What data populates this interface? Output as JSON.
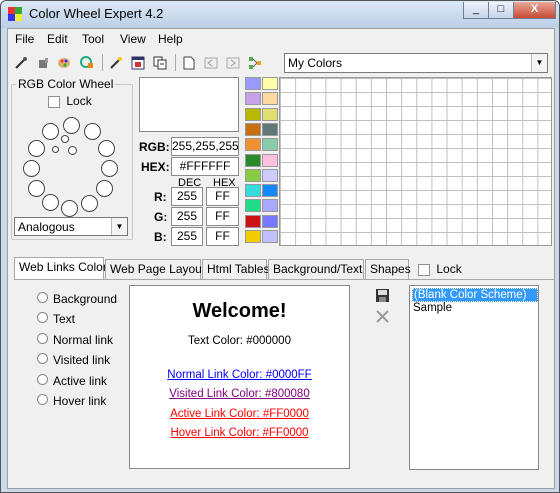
{
  "window": {
    "title": "Color Wheel Expert 4.2",
    "controls": [
      "_",
      "□",
      "X"
    ]
  },
  "menu": [
    {
      "label": "File"
    },
    {
      "label": "Edit"
    },
    {
      "label": "Tool"
    },
    {
      "label": "View"
    },
    {
      "label": "Help"
    }
  ],
  "toolbar": {
    "scheme_combo": "My Colors"
  },
  "wheel_panel": {
    "title": "RGB Color Wheel",
    "lock_label": "Lock",
    "scheme_select": "Analogous"
  },
  "color_info": {
    "rgb_label": "RGB:",
    "rgb_value": "255,255,255",
    "hex_label": "HEX:",
    "hex_value": "#FFFFFF",
    "dec_header": "DEC",
    "hex_header": "HEX",
    "r_label": "R:",
    "g_label": "G:",
    "b_label": "B:",
    "r_dec": "255",
    "g_dec": "255",
    "b_dec": "255",
    "r_hex": "FF",
    "g_hex": "FF",
    "b_hex": "FF",
    "preview_color": "#FFFFFF"
  },
  "palette": {
    "column1": [
      "#9999ff",
      "#c8a2e8",
      "#b8b800",
      "#c87010",
      "#f09030",
      "#2a8a2a",
      "#88cc44",
      "#33dddd",
      "#22dd88",
      "#cc1111",
      "#eecc00"
    ],
    "column2": [
      "#ffffaa",
      "#ffd8a0",
      "#e0e070",
      "#607878",
      "#88ccaa",
      "#ffc0e0",
      "#ccccff",
      "#1188ff",
      "#a8a8ff",
      "#7777ff",
      "#c0c0ff"
    ]
  },
  "tabs": [
    {
      "label": "Web Links Color",
      "active": true
    },
    {
      "label": "Web Page Layout"
    },
    {
      "label": "Html Tables"
    },
    {
      "label": "Background/Text"
    },
    {
      "label": "Shapes"
    }
  ],
  "tabs_lock_label": "Lock",
  "radio_options": [
    "Background",
    "Text",
    "Normal link",
    "Visited link",
    "Active link",
    "Hover link"
  ],
  "preview": {
    "welcome": "Welcome!",
    "text_line": "Text Color: #000000",
    "normal_link": "Normal Link Color: #0000FF",
    "visited_link": "Visited Link Color: #800080",
    "active_link": "Active Link Color: #FF0000",
    "hover_link": "Hover Link Color: #FF0000",
    "colors": {
      "text": "#000000",
      "normal": "#0000FF",
      "visited": "#800080",
      "active": "#FF0000",
      "hover": "#FF0000"
    }
  },
  "schemes_list": [
    {
      "label": "(Blank Color Scheme)",
      "selected": true
    },
    {
      "label": "Sample"
    }
  ]
}
